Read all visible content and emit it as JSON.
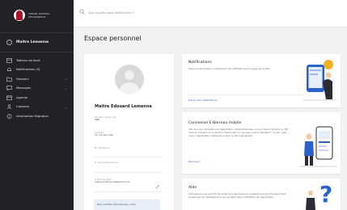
{
  "sidebar": {
    "logo_lines": [
      "CONSEIL NATIONAL",
      "DES BARREAUX"
    ],
    "user_name": "Maître Lemenne",
    "items": [
      {
        "label": "Tableau de bord",
        "icon": "dashboard-icon",
        "chevron": false
      },
      {
        "label": "Notifications (0)",
        "icon": "bell-icon",
        "chevron": false
      },
      {
        "label": "Dossiers",
        "icon": "folder-icon",
        "chevron": true
      },
      {
        "label": "Messages",
        "icon": "message-icon",
        "chevron": true
      },
      {
        "label": "Agenda",
        "icon": "calendar-icon",
        "chevron": false
      },
      {
        "label": "Contacts",
        "icon": "contacts-icon",
        "chevron": true
      },
      {
        "label": "Information Migration",
        "icon": "info-icon",
        "chevron": false
      }
    ]
  },
  "search": {
    "placeholder": "Que voulez-vous rechercher ?"
  },
  "page_title": "Espace personnel",
  "profile": {
    "name": "Maître Edouard Lemenne",
    "fields": [
      {
        "label": "Barreau d'exercice",
        "value": "CNB"
      },
      {
        "label": "Adresse",
        "value": "15 rue des Lilas"
      },
      {
        "label": "N° téléphone",
        "value": ""
      },
      {
        "label": "E-mail professionnel",
        "value": ""
      },
      {
        "label": "E-mail de login",
        "value": "edouard.lemenne@gmail.com"
      }
    ],
    "info_text": "Pour modifier votre barreau, votre"
  },
  "cards": [
    {
      "title": "Notifications",
      "desc": "Vous pouvez activer ou désactiver les notifications envoyées par le site.",
      "link": "Gérer mes notifications"
    },
    {
      "title": "Connexion E-Barreau mobile",
      "desc": "Afin de vous connecter sur l'application mobile E-barreau ou pour devoir générer un QR code en cliquant sur le bouton \"Demander un nouveau code d'activation\" ce lien, puis ouvrir l'application mobile et scanner le QR code généré.",
      "link": "Découvrir"
    },
    {
      "title": "Aide",
      "desc": "Cet espace vous permet d'accéder aux réponses aux questions les plus fréquemment posées par les utilisateurs la vous guidera dans l'utilisation de l'application.",
      "link": ""
    }
  ],
  "colors": {
    "sidebar": "#222226",
    "accent": "#2a62c9",
    "brand_red": "#b0122a"
  }
}
